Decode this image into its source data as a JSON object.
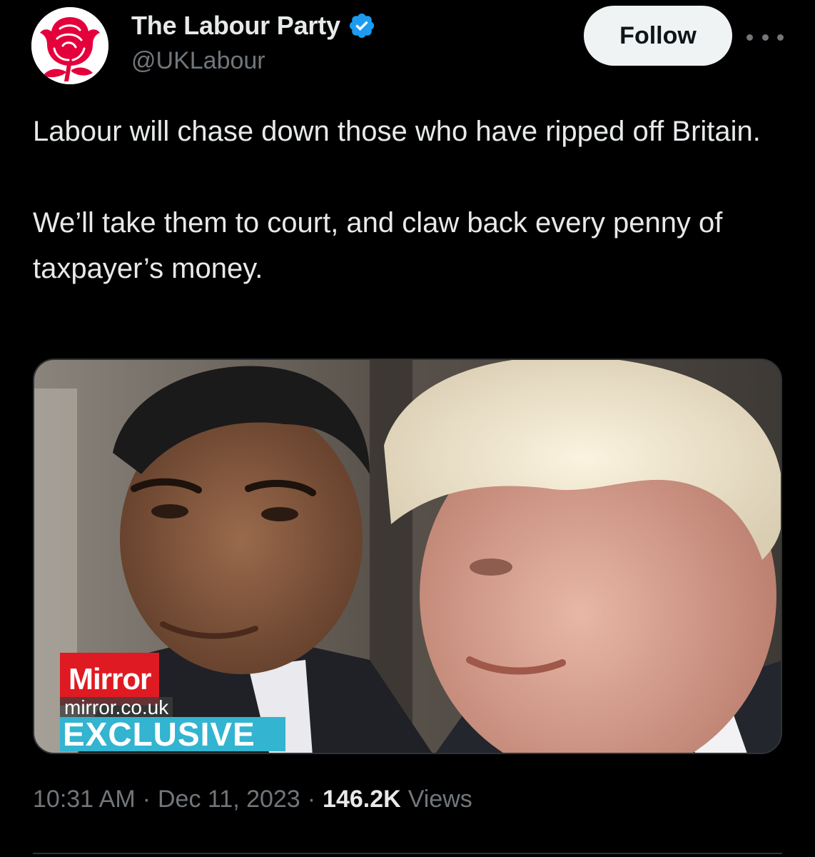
{
  "author": {
    "display_name": "The Labour Party",
    "handle": "@UKLabour",
    "verified": true,
    "avatar_icon": "labour-rose-icon"
  },
  "actions": {
    "follow_label": "Follow",
    "more_icon": "more-options-icon"
  },
  "tweet": {
    "paragraphs": [
      "Labour will chase down those who have ripped off Britain.",
      "We’ll take them to court, and claw back every penny of taxpayer’s money."
    ]
  },
  "media": {
    "mirror_logo": "Mirror",
    "mirror_domain": "mirror.co.uk",
    "exclusive_label": "EXCLUSIVE"
  },
  "meta": {
    "time": "10:31 AM",
    "separator": "·",
    "date": "Dec 11, 2023",
    "views_count": "146.2K",
    "views_label": "Views"
  },
  "colors": {
    "background": "#000000",
    "text_primary": "#e7e9ea",
    "text_secondary": "#71767b",
    "verified_blue": "#1d9bf0",
    "labour_red": "#e4003b",
    "mirror_red": "#e01a22",
    "exclusive_cyan": "#33b4d0"
  }
}
